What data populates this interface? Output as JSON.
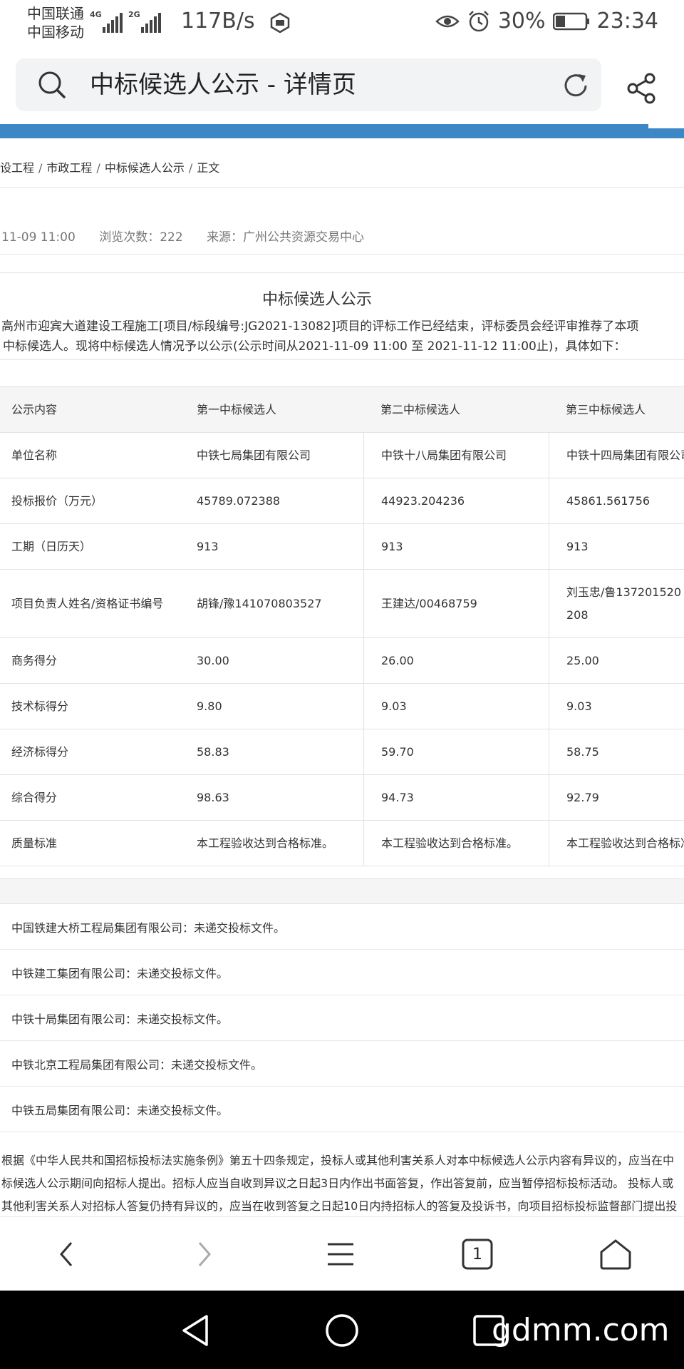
{
  "status_bar": {
    "carrier1": "中国联通",
    "carrier2": "中国移动",
    "net1": "4G",
    "net2": "2G",
    "speed": "117B/s",
    "battery": "30%",
    "time": "23:34"
  },
  "address_bar": {
    "title": "中标候选人公示 - 详情页"
  },
  "breadcrumb": [
    "设工程",
    "市政工程",
    "中标候选人公示",
    "正文"
  ],
  "meta": {
    "date": "11-09 11:00",
    "views": "浏览次数：222",
    "source": "来源：广州公共资源交易中心"
  },
  "article": {
    "title": "中标候选人公示",
    "line1": "高州市迎宾大道建设工程施工[项目/标段编号:JG2021-13082]项目的评标工作已经结束，评标委员会经评审推荐了本项",
    "line2": "中标候选人。现将中标候选人情况予以公示(公示时间从2021-11-09 11:00 至 2021-11-12 11:00止)，具体如下："
  },
  "table": {
    "headers": [
      "公示内容",
      "第一中标候选人",
      "第二中标候选人",
      "第三中标候选人"
    ],
    "rows": [
      [
        "单位名称",
        "中铁七局集团有限公司",
        "中铁十八局集团有限公司",
        "中铁十四局集团有限公司"
      ],
      [
        "投标报价（万元）",
        "45789.072388",
        "44923.204236",
        "45861.561756"
      ],
      [
        "工期（日历天）",
        "913",
        "913",
        "913"
      ],
      [
        "项目负责人姓名/资格证书编号",
        "胡锋/豫141070803527",
        "王建达/00468759",
        "刘玉忠/鲁137201520208"
      ],
      [
        "商务得分",
        "30.00",
        "26.00",
        "25.00"
      ],
      [
        "技术标得分",
        "9.80",
        "9.03",
        "9.03"
      ],
      [
        "经济标得分",
        "58.83",
        "59.70",
        "58.75"
      ],
      [
        "综合得分",
        "98.63",
        "94.73",
        "92.79"
      ],
      [
        "质量标准",
        "本工程验收达到合格标准。",
        "本工程验收达到合格标准。",
        "本工程验收达到合格标准。"
      ]
    ]
  },
  "notes": [
    "中国铁建大桥工程局集团有限公司：未递交投标文件。",
    "中铁建工集团有限公司：未递交投标文件。",
    "中铁十局集团有限公司：未递交投标文件。",
    "中铁北京工程局集团有限公司：未递交投标文件。",
    "中铁五局集团有限公司：未递交投标文件。"
  ],
  "legal": {
    "line1": "根据《中华人民共和国招标投标法实施条例》第五十四条规定，投标人或其他利害关系人对本中标候选人公示内容有异议的，应当在中",
    "line2": "标候选人公示期间向招标人提出。招标人应当自收到异议之日起3日内作出书面答复，作出答复前，应当暂停招标投标活动。 投标人或",
    "line3": "其他利害关系人对招标人答复仍持有异议的，应当在收到答复之日起10日内持招标人的答复及投诉书，向项目招标投标监督部门提出投"
  },
  "toolbar": {
    "tab_count": "1"
  },
  "watermark": "gdmm.com",
  "colors": {
    "accent_bar": "#3d87c6"
  }
}
